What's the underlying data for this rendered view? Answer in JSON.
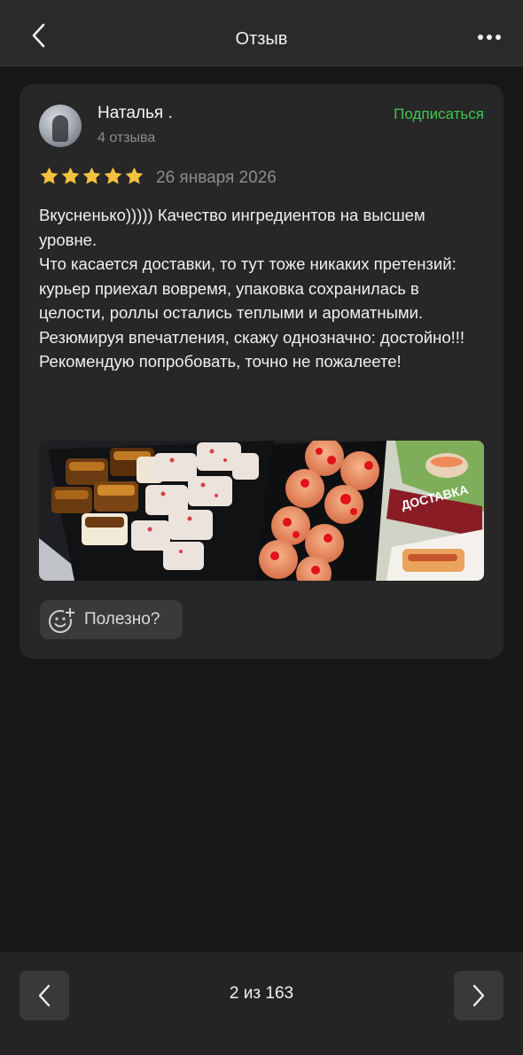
{
  "header": {
    "title": "Отзыв",
    "back_icon": "chevron-left-icon",
    "more_icon": "more-dots-icon"
  },
  "review": {
    "author": {
      "name": "Наталья .",
      "reviews_count": "4 отзыва",
      "subscribe_label": "Подписаться"
    },
    "rating": 5,
    "rating_max": 5,
    "date": "26 января 2026",
    "text": [
      "Вкусненько))))) Качество ингредиентов на высшем уровне.",
      "Что касается доставки, то тут тоже никаких претензий: курьер приехал вовремя, упаковка сохранилась в целости, роллы остались теплыми и ароматными.",
      "Резюмируя впечатления, скажу однозначно: достойно!!! Рекомендую попробовать, точно не пожалеете!"
    ],
    "photo": {
      "package_text": "ДОСТАВКА"
    },
    "useful_label": "Полезно?"
  },
  "footer": {
    "counter": "2 из 163"
  },
  "colors": {
    "accent_green": "#3fc64f",
    "star": "#f5c23d",
    "card_bg": "#272727",
    "page_bg": "#171717"
  }
}
